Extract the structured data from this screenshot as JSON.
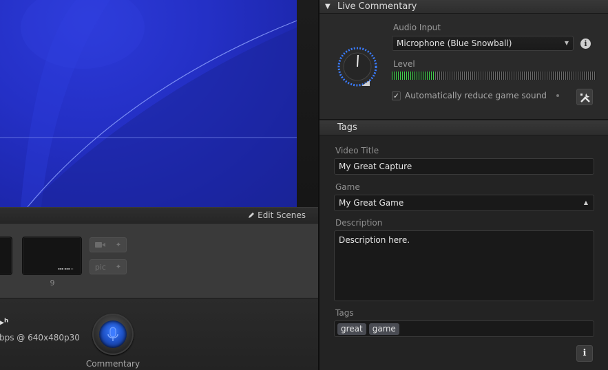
{
  "live_commentary": {
    "title": "Live Commentary",
    "audio_input_label": "Audio Input",
    "audio_input_value": "Microphone (Blue Snowball)",
    "level_label": "Level",
    "level_fraction": 0.21,
    "auto_reduce_label": "Automatically reduce game sound",
    "auto_reduce_checked": true
  },
  "tags_section": {
    "title": "Tags",
    "video_title_label": "Video Title",
    "video_title_value": "My Great Capture",
    "game_label": "Game",
    "game_value": "My Great Game",
    "description_label": "Description",
    "description_value": "Description here.",
    "tags_label": "Tags",
    "tags": [
      "great",
      "game"
    ]
  },
  "scenes": {
    "edit_label": "Edit Scenes",
    "thumb_label": "9",
    "pic_label": "pic"
  },
  "status": {
    "bitrate_text": "bps @ 640x480p30",
    "commentary_label": "Commentary"
  },
  "icons": [
    "pencil-icon",
    "camera-icon",
    "plus-icon",
    "microphone-icon",
    "volume-knob-icon",
    "info-icon",
    "tools-icon",
    "dropdown-caret-icon"
  ],
  "colors": {
    "accent_blue": "#1f53c8",
    "level_green": "#3fd24b",
    "preview_blue": "#2430c6"
  }
}
